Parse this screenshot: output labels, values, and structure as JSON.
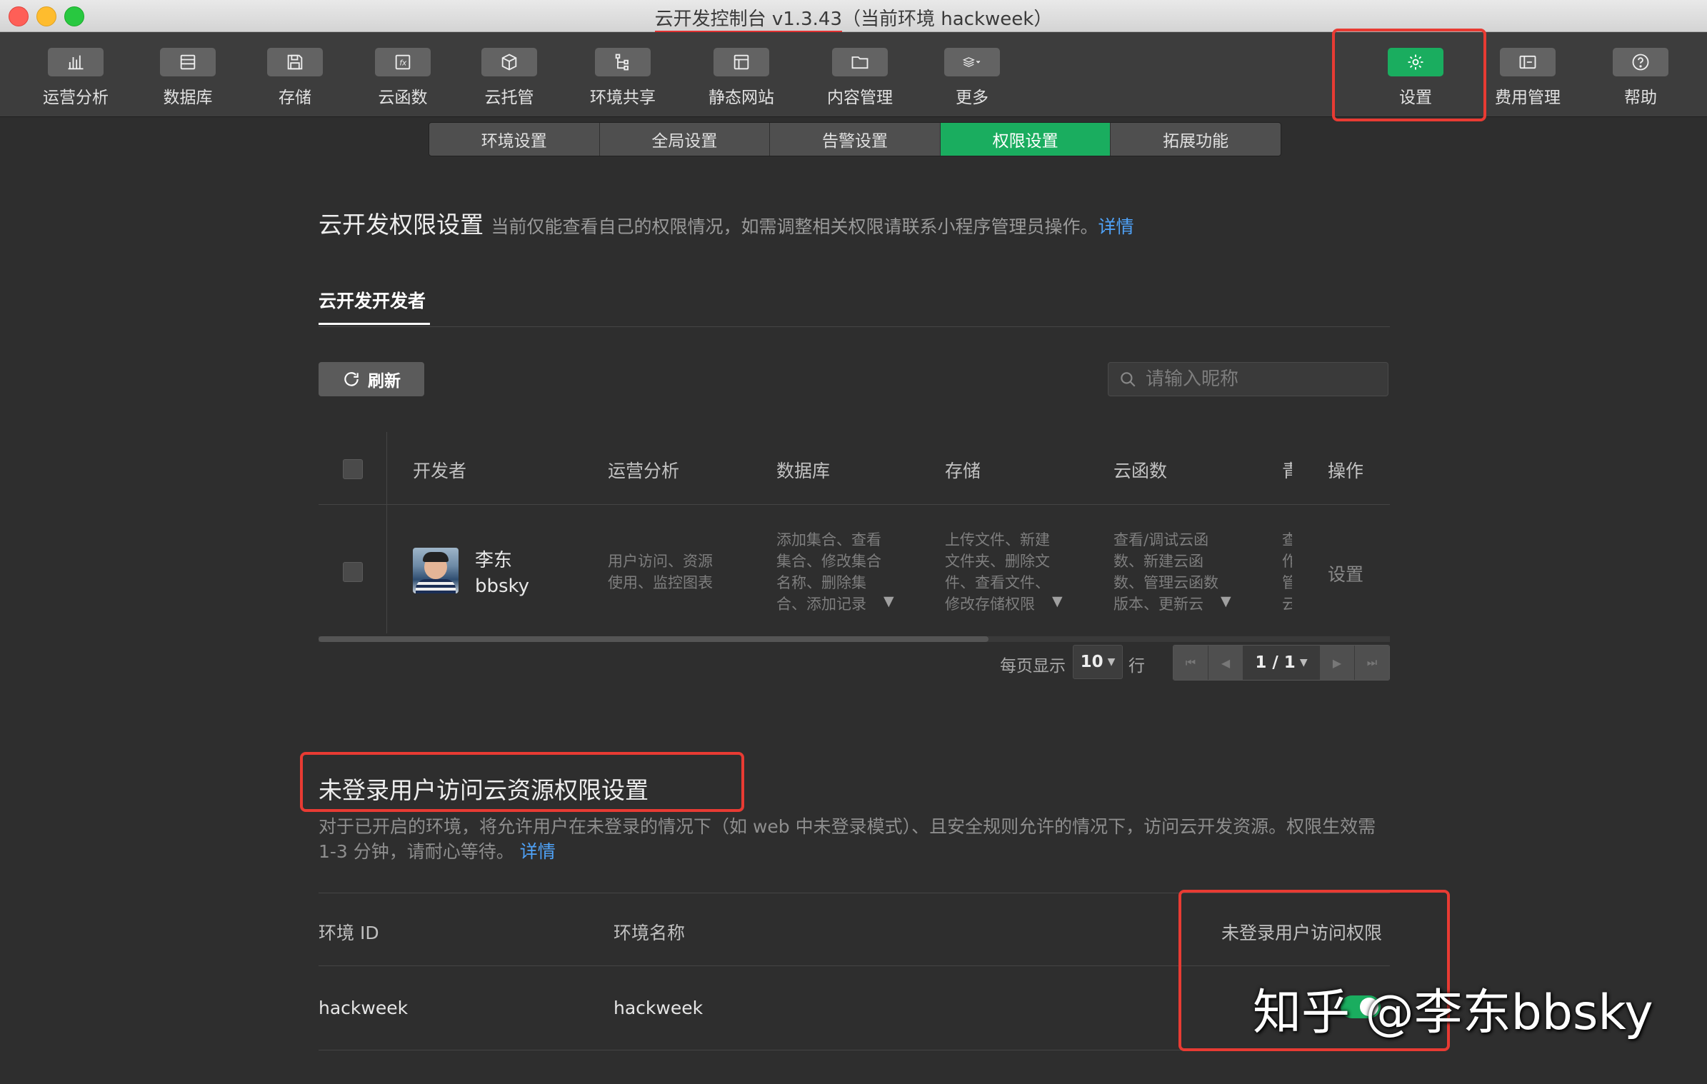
{
  "window": {
    "title": "云开发控制台 v1.3.43",
    "env_suffix": "（当前环境 hackweek）"
  },
  "toolbar": {
    "items": [
      {
        "label": "运营分析",
        "icon": "bar-chart-icon"
      },
      {
        "label": "数据库",
        "icon": "database-icon"
      },
      {
        "label": "存储",
        "icon": "save-icon"
      },
      {
        "label": "云函数",
        "icon": "function-icon"
      },
      {
        "label": "云托管",
        "icon": "cube-icon"
      },
      {
        "label": "环境共享",
        "icon": "share-tree-icon"
      },
      {
        "label": "静态网站",
        "icon": "browser-window-icon"
      },
      {
        "label": "内容管理",
        "icon": "folder-icon"
      },
      {
        "label": "更多",
        "icon": "layers-icon"
      },
      {
        "label": "设置",
        "icon": "gear-icon"
      },
      {
        "label": "费用管理",
        "icon": "billing-icon"
      },
      {
        "label": "帮助",
        "icon": "help-icon"
      }
    ]
  },
  "subtabs": [
    "环境设置",
    "全局设置",
    "告警设置",
    "权限设置",
    "拓展功能"
  ],
  "permissions": {
    "title": "云开发权限设置",
    "desc": "当前仅能查看自己的权限情况，如需调整相关权限请联系小程序管理员操作。",
    "link": "详情",
    "tab": "云开发开发者",
    "refresh": "刷新",
    "search_placeholder": "请输入昵称",
    "columns": [
      "开发者",
      "运营分析",
      "数据库",
      "存储",
      "云函数",
      "青",
      "操作"
    ],
    "row": {
      "name": "李东",
      "nick": "bbsky",
      "analytics": [
        "用户访问、资源",
        "使用、监控图表"
      ],
      "database": [
        "添加集合、查看",
        "集合、修改集合",
        "名称、删除集",
        "合、添加记录"
      ],
      "storage": [
        "上传文件、新建",
        "文件夹、删除文",
        "件、查看文件、",
        "修改存储权限"
      ],
      "functions": [
        "查看/调试云函",
        "数、新建云函",
        "数、管理云函数",
        "版本、更新云"
      ],
      "partial": [
        "查",
        "作",
        "管",
        "云"
      ],
      "action": "设置"
    },
    "pager": {
      "per_page_label": "每页显示",
      "per_page": "10",
      "rows_label": "行",
      "page": "1 / 1"
    }
  },
  "unauth": {
    "title": "未登录用户访问云资源权限设置",
    "desc": "对于已开启的环境，将允许用户在未登录的情况下（如 web 中未登录模式）、且安全规则允许的情况下，访问云开发资源。权限生效需 1-3 分钟，请耐心等待。",
    "link": "详情",
    "columns": [
      "环境 ID",
      "环境名称",
      "未登录用户访问权限"
    ],
    "row": {
      "env_id": "hackweek",
      "env_name": "hackweek",
      "enabled": true
    }
  },
  "watermark": "知乎 @李东bbsky",
  "colors": {
    "accent": "#1aad5f",
    "highlight": "#e83b33",
    "link": "#4fa2f7"
  }
}
